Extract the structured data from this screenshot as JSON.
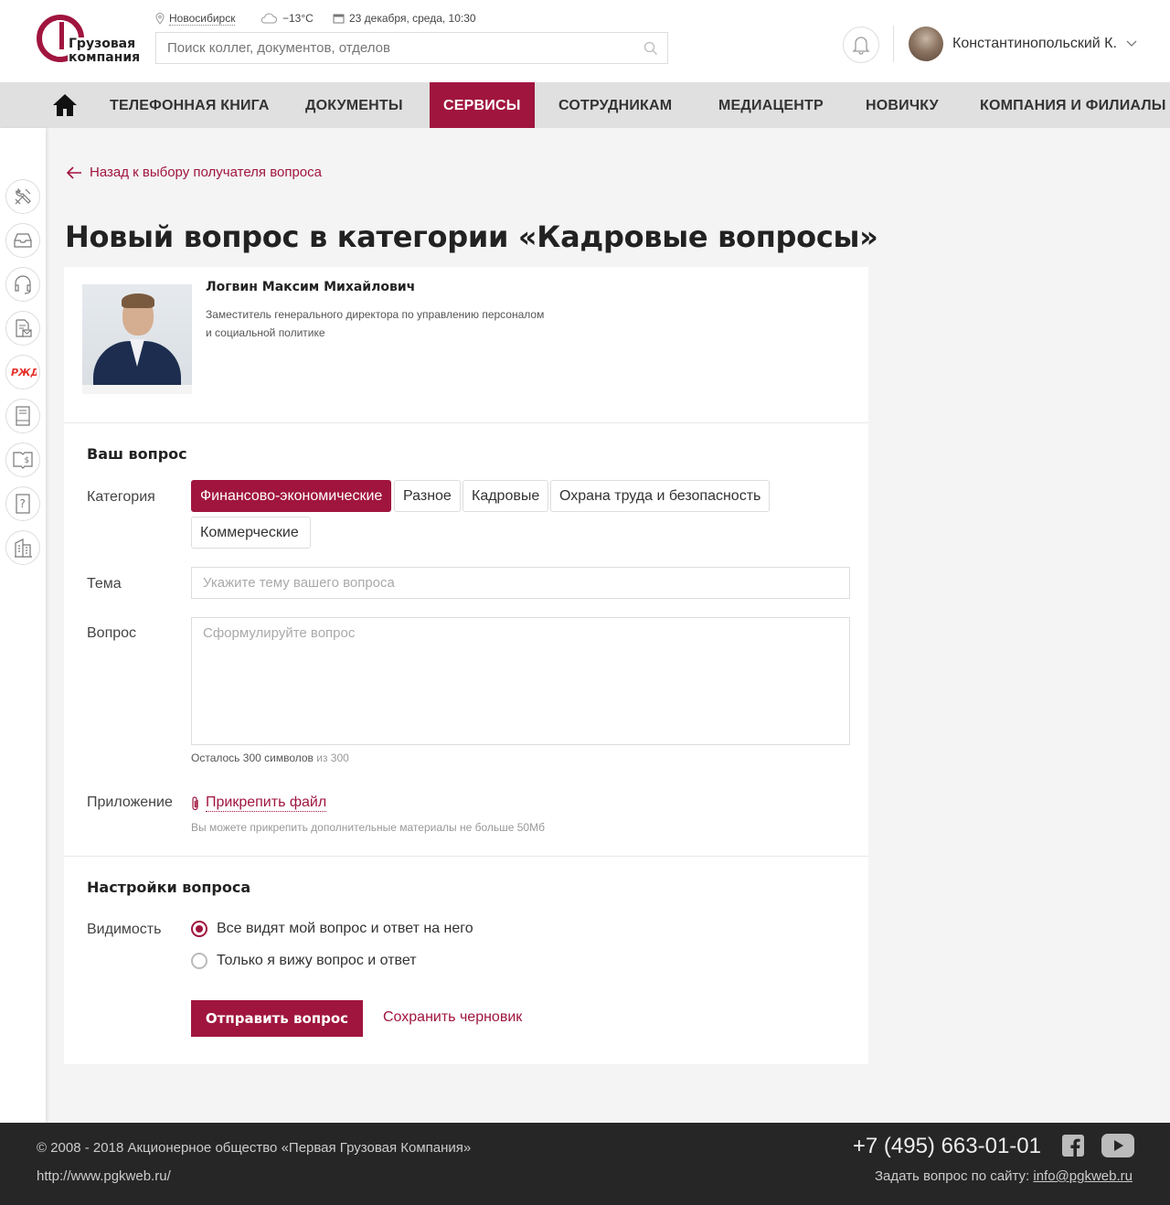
{
  "brand": {
    "line1": "Грузовая",
    "line2": "компания",
    "color": "#a0153e"
  },
  "header": {
    "city": "Новосибирск",
    "weather": "−13°C",
    "datetime": "23 декабря, среда, 10:30",
    "search_placeholder": "Поиск коллег, документов, отделов",
    "user_name": "Константинопольский К."
  },
  "nav": {
    "items": [
      "ТЕЛЕФОННАЯ КНИГА",
      "ДОКУМЕНТЫ",
      "СЕРВИСЫ",
      "СОТРУДНИКАМ",
      "МЕДИАЦЕНТР",
      "НОВИЧКУ",
      "КОМПАНИЯ И ФИЛИАЛЫ"
    ],
    "active": "СЕРВИСЫ"
  },
  "sidebar": {
    "icons": [
      "tools-icon",
      "inbox-icon",
      "headset-icon",
      "document-mail-icon",
      "rzd-logo-icon",
      "book-icon",
      "manual-icon",
      "faq-icon",
      "building-icon"
    ]
  },
  "page": {
    "back_link": "Назад к выбору получателя вопроса",
    "title": "Новый вопрос в категории «Кадровые вопросы»"
  },
  "recipient": {
    "name": "Логвин Максим Михайлович",
    "position_line1": "Заместитель генерального директора по управлению персоналом",
    "position_line2": "и социальной политике"
  },
  "question": {
    "section_title": "Ваш вопрос",
    "category_label": "Категория",
    "categories": [
      "Финансово-экономические",
      "Разное",
      "Кадровые",
      "Охрана труда и безопасность",
      "Коммерческие"
    ],
    "selected_category": "Финансово-экономические",
    "topic_label": "Тема",
    "topic_placeholder": "Укажите тему вашего вопроса",
    "question_label": "Вопрос",
    "question_placeholder": "Сформулируйте вопрос",
    "chars_left": "Осталось 300 символов",
    "chars_total": "из 300",
    "attachment_label": "Приложение",
    "attach_link": "Прикрепить файл",
    "attach_hint": "Вы можете прикрепить дополнительные материалы не больше 50Мб"
  },
  "settings": {
    "section_title": "Настройки вопроса",
    "visibility_label": "Видимость",
    "options": [
      "Все видят мой вопрос и ответ на него",
      "Только я вижу вопрос и ответ"
    ],
    "selected": 0,
    "submit": "Отправить вопрос",
    "save_draft": "Сохранить черновик"
  },
  "footer": {
    "copyright": "© 2008 - 2018 Акционерное общество «Первая Грузовая Компания»",
    "url": "http://www.pgkweb.ru/",
    "phone": "+7 (495) 663-01-01",
    "ask_text": "Задать вопрос по сайту:",
    "email": "info@pgkweb.ru"
  }
}
